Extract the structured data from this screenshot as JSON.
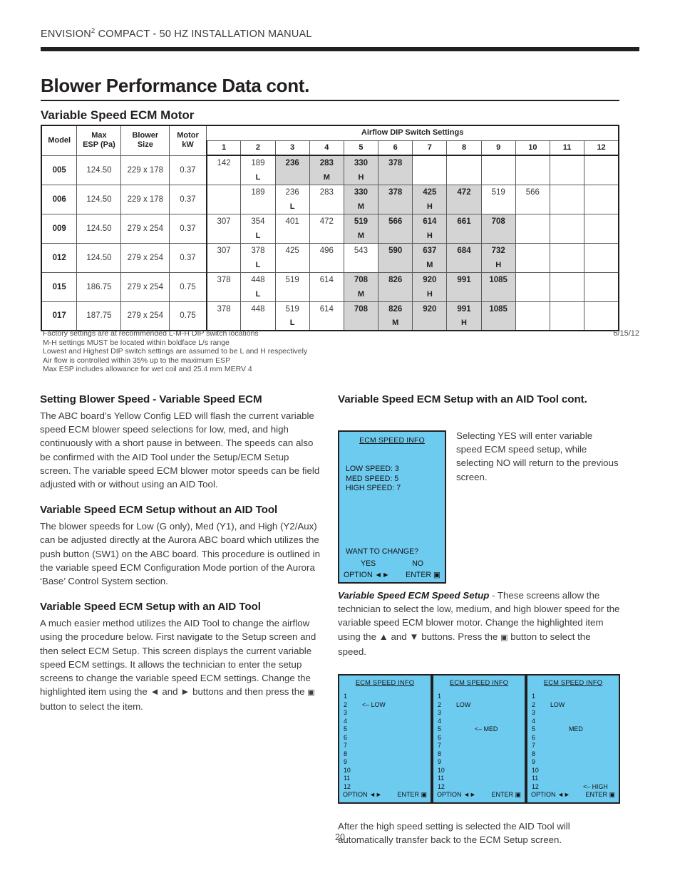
{
  "header": {
    "title_main": "ENVISION",
    "title_sup": "2",
    "title_rest": " COMPACT - 50 HZ INSTALLATION MANUAL"
  },
  "page_title": "Blower Performance Data cont.",
  "section_title": "Variable Speed ECM Motor",
  "table": {
    "group_header": "Airflow DIP Switch Settings",
    "headers": {
      "model": "Model",
      "max_esp": "Max\nESP (Pa)",
      "max_esp_l1": "Max",
      "max_esp_l2": "ESP (Pa)",
      "blower_l1": "Blower",
      "blower_l2": "Size",
      "motor_l1": "Motor",
      "motor_l2": "kW"
    },
    "dip_columns": [
      "1",
      "2",
      "3",
      "4",
      "5",
      "6",
      "7",
      "8",
      "9",
      "10",
      "11",
      "12"
    ],
    "rows": [
      {
        "model": "005",
        "max_esp": "124.50",
        "blower_size": "229 x 178",
        "motor_kw": "0.37",
        "cells": [
          {
            "v": "142",
            "m": "",
            "shaded": false
          },
          {
            "v": "189",
            "m": "L",
            "shaded": false
          },
          {
            "v": "236",
            "m": "",
            "shaded": true
          },
          {
            "v": "283",
            "m": "M",
            "shaded": true
          },
          {
            "v": "330",
            "m": "H",
            "shaded": true
          },
          {
            "v": "378",
            "m": "",
            "shaded": true
          },
          {
            "v": "",
            "m": "",
            "shaded": false
          },
          {
            "v": "",
            "m": "",
            "shaded": false
          },
          {
            "v": "",
            "m": "",
            "shaded": false
          },
          {
            "v": "",
            "m": "",
            "shaded": false
          },
          {
            "v": "",
            "m": "",
            "shaded": false
          },
          {
            "v": "",
            "m": "",
            "shaded": false
          }
        ]
      },
      {
        "model": "006",
        "max_esp": "124.50",
        "blower_size": "229 x 178",
        "motor_kw": "0.37",
        "cells": [
          {
            "v": "",
            "m": "",
            "shaded": false
          },
          {
            "v": "189",
            "m": "",
            "shaded": false
          },
          {
            "v": "236",
            "m": "L",
            "shaded": false
          },
          {
            "v": "283",
            "m": "",
            "shaded": false
          },
          {
            "v": "330",
            "m": "M",
            "shaded": true
          },
          {
            "v": "378",
            "m": "",
            "shaded": true
          },
          {
            "v": "425",
            "m": "H",
            "shaded": true
          },
          {
            "v": "472",
            "m": "",
            "shaded": true
          },
          {
            "v": "519",
            "m": "",
            "shaded": false
          },
          {
            "v": "566",
            "m": "",
            "shaded": false
          },
          {
            "v": "",
            "m": "",
            "shaded": false
          },
          {
            "v": "",
            "m": "",
            "shaded": false
          }
        ]
      },
      {
        "model": "009",
        "max_esp": "124.50",
        "blower_size": "279 x 254",
        "motor_kw": "0.37",
        "cells": [
          {
            "v": "307",
            "m": "",
            "shaded": false
          },
          {
            "v": "354",
            "m": "L",
            "shaded": false
          },
          {
            "v": "401",
            "m": "",
            "shaded": false
          },
          {
            "v": "472",
            "m": "",
            "shaded": false
          },
          {
            "v": "519",
            "m": "M",
            "shaded": true
          },
          {
            "v": "566",
            "m": "",
            "shaded": true
          },
          {
            "v": "614",
            "m": "H",
            "shaded": true
          },
          {
            "v": "661",
            "m": "",
            "shaded": true
          },
          {
            "v": "708",
            "m": "",
            "shaded": true
          },
          {
            "v": "",
            "m": "",
            "shaded": false
          },
          {
            "v": "",
            "m": "",
            "shaded": false
          },
          {
            "v": "",
            "m": "",
            "shaded": false
          }
        ]
      },
      {
        "model": "012",
        "max_esp": "124.50",
        "blower_size": "279 x 254",
        "motor_kw": "0.37",
        "cells": [
          {
            "v": "307",
            "m": "",
            "shaded": false
          },
          {
            "v": "378",
            "m": "L",
            "shaded": false
          },
          {
            "v": "425",
            "m": "",
            "shaded": false
          },
          {
            "v": "496",
            "m": "",
            "shaded": false
          },
          {
            "v": "543",
            "m": "",
            "shaded": false
          },
          {
            "v": "590",
            "m": "",
            "shaded": true
          },
          {
            "v": "637",
            "m": "M",
            "shaded": true
          },
          {
            "v": "684",
            "m": "",
            "shaded": true
          },
          {
            "v": "732",
            "m": "H",
            "shaded": true
          },
          {
            "v": "",
            "m": "",
            "shaded": false
          },
          {
            "v": "",
            "m": "",
            "shaded": false
          },
          {
            "v": "",
            "m": "",
            "shaded": false
          }
        ]
      },
      {
        "model": "015",
        "max_esp": "186.75",
        "blower_size": "279 x 254",
        "motor_kw": "0.75",
        "cells": [
          {
            "v": "378",
            "m": "",
            "shaded": false
          },
          {
            "v": "448",
            "m": "L",
            "shaded": false
          },
          {
            "v": "519",
            "m": "",
            "shaded": false
          },
          {
            "v": "614",
            "m": "",
            "shaded": false
          },
          {
            "v": "708",
            "m": "M",
            "shaded": true
          },
          {
            "v": "826",
            "m": "",
            "shaded": true
          },
          {
            "v": "920",
            "m": "H",
            "shaded": true
          },
          {
            "v": "991",
            "m": "",
            "shaded": true
          },
          {
            "v": "1085",
            "m": "",
            "shaded": true
          },
          {
            "v": "",
            "m": "",
            "shaded": false
          },
          {
            "v": "",
            "m": "",
            "shaded": false
          },
          {
            "v": "",
            "m": "",
            "shaded": false
          }
        ]
      },
      {
        "model": "017",
        "max_esp": "187.75",
        "blower_size": "279 x 254",
        "motor_kw": "0.75",
        "cells": [
          {
            "v": "378",
            "m": "",
            "shaded": false
          },
          {
            "v": "448",
            "m": "",
            "shaded": false
          },
          {
            "v": "519",
            "m": "L",
            "shaded": false
          },
          {
            "v": "614",
            "m": "",
            "shaded": false
          },
          {
            "v": "708",
            "m": "",
            "shaded": true
          },
          {
            "v": "826",
            "m": "M",
            "shaded": true
          },
          {
            "v": "920",
            "m": "",
            "shaded": true
          },
          {
            "v": "991",
            "m": "H",
            "shaded": true
          },
          {
            "v": "1085",
            "m": "",
            "shaded": true
          },
          {
            "v": "",
            "m": "",
            "shaded": false
          },
          {
            "v": "",
            "m": "",
            "shaded": false
          },
          {
            "v": "",
            "m": "",
            "shaded": false
          }
        ]
      }
    ]
  },
  "footnotes": {
    "line1": "Factory settings are at recommended L-M-H DIP switch locations",
    "line2": "M-H settings MUST be located within boldface L/s range",
    "line3": "Lowest and Highest DIP switch settings are assumed to be L and H respectively",
    "line4": "Air flow is controlled within 35% up to the maximum ESP",
    "line5": "Max ESP includes allowance for wet coil and 25.4 mm MERV 4",
    "date": "6/15/12"
  },
  "left_column": {
    "heading1": "Setting Blower Speed - Variable Speed ECM",
    "para1": "The ABC board’s Yellow Config LED will flash the current variable speed ECM blower speed selections for low, med, and high continuously with a short pause in between. The speeds can also be confirmed with the AID Tool under the Setup/ECM Setup screen. The variable speed ECM blower motor speeds can be field adjusted with or without using an AID Tool.",
    "heading2": "Variable Speed ECM Setup without an AID Tool",
    "para2": "The blower speeds for Low (G only), Med (Y1), and High (Y2/Aux) can be adjusted directly at the Aurora ABC board which utilizes the push button (SW1) on the ABC board. This procedure is outlined in the variable speed ECM Configuration Mode portion of the Aurora ‘Base’ Control System section.",
    "heading3": "Variable Speed ECM Setup with an AID Tool",
    "para3_a": "A much easier method utilizes the AID Tool to change the airflow using the procedure below. First navigate to the Setup screen and then select ECM Setup. This screen displays the current variable speed ECM settings. It allows the technician to enter the setup screens to change the variable speed ECM settings. Change the highlighted item using the ◄ and ► buttons and then press the ",
    "para3_sq": "▣",
    "para3_b": " button to select the item."
  },
  "right_column": {
    "heading1": "Variable Speed ECM Setup with an AID Tool cont.",
    "side_text": "Selecting YES will enter variable speed ECM speed setup, while selecting NO will return to the previous screen.",
    "aid_big": {
      "title": "ECM SPEED INFO",
      "low": "LOW SPEED:  3",
      "med": "MED SPEED:  5",
      "high": "HIGH SPEED:  7",
      "prompt": "WANT TO CHANGE?",
      "yes": "YES",
      "no": "NO",
      "option": "OPTION ◄►",
      "enter": "ENTER ▣"
    },
    "italic_lead_bold": "Variable Speed ECM Speed Setup",
    "italic_lead_rest": " - These screens allow the technician to  select the low, medium, and high blower speed for the variable speed ECM blower motor. Change the highlighted item using the ▲ and ▼ buttons. Press the ",
    "italic_lead_sq": "▣",
    "italic_lead_tail": " button to select the speed.",
    "small_screens": [
      {
        "title": "ECM SPEED INFO",
        "numbers": [
          "1",
          "2",
          "3",
          "4",
          "5",
          "6",
          "7",
          "8",
          "9",
          "10",
          "11",
          "12"
        ],
        "labels": {
          "2": "<– LOW"
        },
        "label_indent": {
          "2": 26
        },
        "option": "OPTION ◄►",
        "enter": "ENTER ▣"
      },
      {
        "title": "ECM SPEED INFO",
        "numbers": [
          "1",
          "2",
          "3",
          "4",
          "5",
          "6",
          "7",
          "8",
          "9",
          "10",
          "11",
          "12"
        ],
        "labels": {
          "2": "LOW",
          "5": "<– MED"
        },
        "label_indent": {
          "2": 26,
          "5": 52
        },
        "option": "OPTION ◄►",
        "enter": "ENTER ▣"
      },
      {
        "title": "ECM SPEED INFO",
        "numbers": [
          "1",
          "2",
          "3",
          "4",
          "5",
          "6",
          "7",
          "8",
          "9",
          "10",
          "11",
          "12"
        ],
        "labels": {
          "2": "LOW",
          "5": "MED",
          "12": "<– HIGH"
        },
        "label_indent": {
          "2": 26,
          "5": 52,
          "12": 72
        },
        "option": "OPTION ◄►",
        "enter": "ENTER ▣"
      }
    ],
    "bottom_note": "After the high speed setting is selected the AID Tool will automatically transfer back to the ECM Setup screen."
  },
  "page_number": "20",
  "colors": {
    "screen_blue": "#6ECBF0",
    "shaded_cell": "#d4d4d4",
    "ink": "#231f20"
  }
}
